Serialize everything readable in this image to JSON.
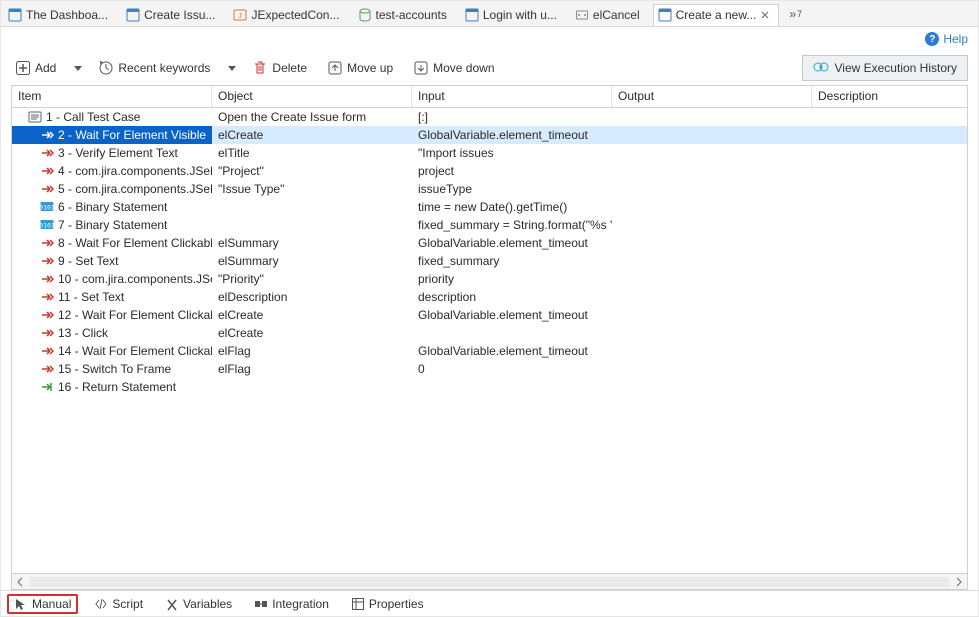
{
  "tabs": {
    "items": [
      {
        "label": "The Dashboa...",
        "type": "web"
      },
      {
        "label": "Create Issu...",
        "type": "web"
      },
      {
        "label": "JExpectedCon...",
        "type": "groovy"
      },
      {
        "label": "test-accounts",
        "type": "db"
      },
      {
        "label": "Login with u...",
        "type": "web"
      },
      {
        "label": "elCancel",
        "type": "object"
      },
      {
        "label": "Create a new...",
        "type": "web",
        "active": true
      }
    ],
    "overflow_count": "7",
    "overflow_prefix": "»"
  },
  "help": {
    "label": "Help"
  },
  "toolbar": {
    "add_label": "Add",
    "recent_keywords_label": "Recent keywords",
    "delete_label": "Delete",
    "move_up_label": "Move up",
    "move_down_label": "Move down",
    "view_history_label": "View Execution History"
  },
  "grid": {
    "columns": {
      "item": "Item",
      "object": "Object",
      "input": "Input",
      "output": "Output",
      "description": "Description"
    },
    "rows": [
      {
        "icon": "call",
        "item": "1 - Call Test Case",
        "object": "Open the Create Issue form",
        "input": "[:]",
        "output": "",
        "description": ""
      },
      {
        "icon": "kw",
        "item": "2 - Wait For Element Visible",
        "object": "elCreate",
        "input": "GlobalVariable.element_timeout",
        "output": "",
        "description": "",
        "selected": true
      },
      {
        "icon": "kw",
        "item": "3 - Verify Element Text",
        "object": "elTitle",
        "input": "\"Import issues",
        "output": "",
        "description": ""
      },
      {
        "icon": "kw",
        "item": "4 - com.jira.components.JSel",
        "object": "\"Project\"",
        "input": "project",
        "output": "",
        "description": ""
      },
      {
        "icon": "kw",
        "item": "5 - com.jira.components.JSel",
        "object": "\"Issue Type\"",
        "input": "issueType",
        "output": "",
        "description": ""
      },
      {
        "icon": "bin",
        "item": "6 - Binary Statement",
        "object": "",
        "input": "time = new Date().getTime()",
        "output": "",
        "description": ""
      },
      {
        "icon": "bin",
        "item": "7 - Binary Statement",
        "object": "",
        "input": "fixed_summary = String.format(\"%s '",
        "output": "",
        "description": ""
      },
      {
        "icon": "kw",
        "item": "8 - Wait For Element Clickabl",
        "object": "elSummary",
        "input": "GlobalVariable.element_timeout",
        "output": "",
        "description": ""
      },
      {
        "icon": "kw",
        "item": "9 - Set Text",
        "object": "elSummary",
        "input": "fixed_summary",
        "output": "",
        "description": ""
      },
      {
        "icon": "kw",
        "item": "10 - com.jira.components.JSe",
        "object": "\"Priority\"",
        "input": "priority",
        "output": "",
        "description": ""
      },
      {
        "icon": "kw",
        "item": "11 - Set Text",
        "object": "elDescription",
        "input": "description",
        "output": "",
        "description": ""
      },
      {
        "icon": "kw",
        "item": "12 - Wait For Element Clickab",
        "object": "elCreate",
        "input": "GlobalVariable.element_timeout",
        "output": "",
        "description": ""
      },
      {
        "icon": "kw",
        "item": "13 - Click",
        "object": "elCreate",
        "input": "",
        "output": "",
        "description": ""
      },
      {
        "icon": "kw",
        "item": "14 - Wait For Element Clickab",
        "object": "elFlag",
        "input": "GlobalVariable.element_timeout",
        "output": "",
        "description": ""
      },
      {
        "icon": "kw",
        "item": "15 - Switch To Frame",
        "object": "elFlag",
        "input": "0",
        "output": "",
        "description": ""
      },
      {
        "icon": "ret",
        "item": "16 - Return Statement",
        "object": "",
        "input": "",
        "output": "",
        "description": ""
      }
    ]
  },
  "bottom_tabs": {
    "manual": "Manual",
    "script": "Script",
    "variables": "Variables",
    "integration": "Integration",
    "properties": "Properties"
  }
}
